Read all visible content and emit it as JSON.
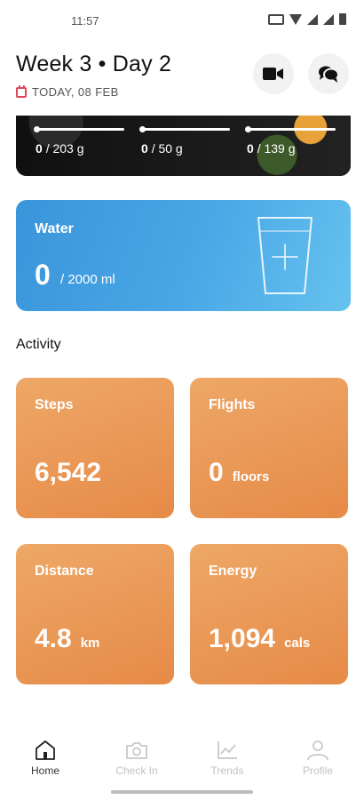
{
  "status_bar": {
    "time": "11:57"
  },
  "header": {
    "title": "Week 3 • Day 2",
    "date": "TODAY, 08 FEB",
    "video_icon": "video-camera-icon",
    "chat_icon": "chat-bubbles-icon"
  },
  "macros": [
    {
      "current": "0",
      "target": "/ 203 g"
    },
    {
      "current": "0",
      "target": "/ 50 g"
    },
    {
      "current": "0",
      "target": "/ 139 g"
    }
  ],
  "water": {
    "title": "Water",
    "value": "0",
    "goal": "/ 2000 ml",
    "add_icon": "plus-icon"
  },
  "activity": {
    "section_label": "Activity",
    "cards": [
      {
        "title": "Steps",
        "value": "6,542",
        "unit": ""
      },
      {
        "title": "Flights",
        "value": "0",
        "unit": "floors"
      },
      {
        "title": "Distance",
        "value": "4.8",
        "unit": "km"
      },
      {
        "title": "Energy",
        "value": "1,094",
        "unit": "cals"
      }
    ]
  },
  "nav": {
    "items": [
      {
        "label": "Home",
        "icon": "home-icon",
        "active": true
      },
      {
        "label": "Check In",
        "icon": "camera-icon",
        "active": false
      },
      {
        "label": "Trends",
        "icon": "chart-icon",
        "active": false
      },
      {
        "label": "Profile",
        "icon": "user-icon",
        "active": false
      }
    ]
  },
  "colors": {
    "water_gradient_start": "#3a94da",
    "water_gradient_end": "#66c2ef",
    "activity_gradient_start": "#eea867",
    "activity_gradient_end": "#e68a47",
    "calendar_accent": "#e0475b"
  }
}
